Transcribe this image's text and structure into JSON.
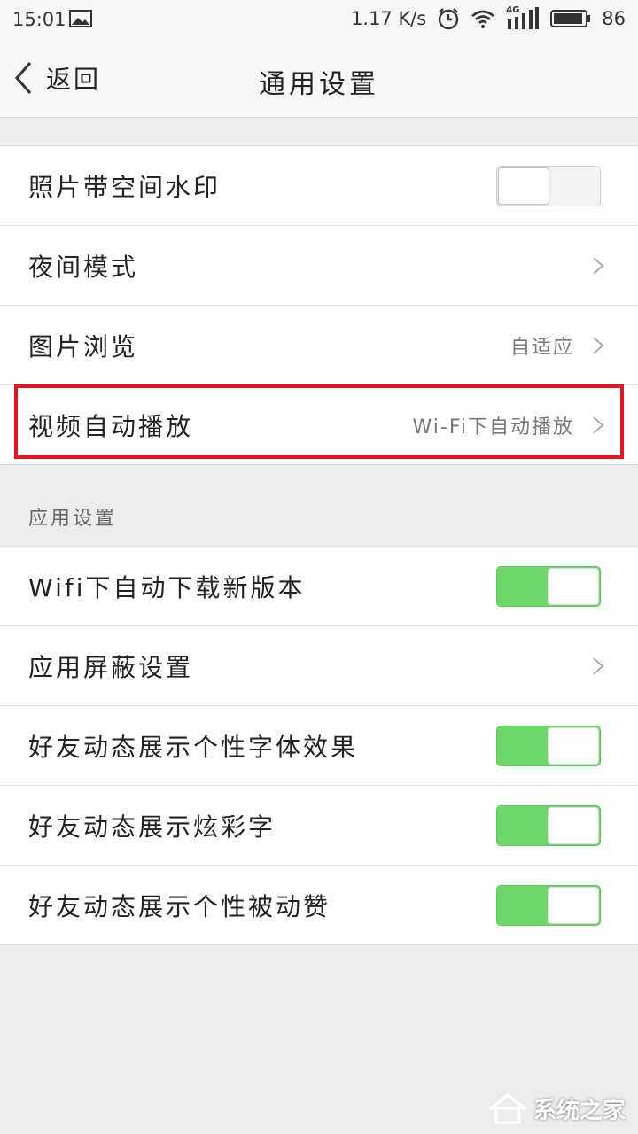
{
  "status_bar": {
    "time": "15:01",
    "network_speed": "1.17 K/s",
    "network_type": "4G",
    "battery": "86",
    "icons": [
      "image-icon",
      "alarm-icon",
      "wifi-icon",
      "signal-icon",
      "battery-icon"
    ]
  },
  "nav": {
    "back_label": "返回",
    "title": "通用设置"
  },
  "group1": {
    "items": [
      {
        "label": "照片带空间水印",
        "control": "toggle",
        "on": false
      },
      {
        "label": "夜间模式",
        "control": "chevron"
      },
      {
        "label": "图片浏览",
        "value": "自适应",
        "control": "chevron"
      },
      {
        "label": "视频自动播放",
        "value": "Wi-Fi下自动播放",
        "control": "chevron",
        "highlighted": true
      }
    ]
  },
  "section2": {
    "header": "应用设置",
    "items": [
      {
        "label": "Wifi下自动下载新版本",
        "control": "toggle",
        "on": true
      },
      {
        "label": "应用屏蔽设置",
        "control": "chevron"
      },
      {
        "label": "好友动态展示个性字体效果",
        "control": "toggle",
        "on": true
      },
      {
        "label": "好友动态展示炫彩字",
        "control": "toggle",
        "on": true
      },
      {
        "label": "好友动态展示个性被动赞",
        "control": "toggle",
        "on": true
      }
    ]
  },
  "watermark": {
    "text": "系统之家"
  },
  "colors": {
    "toggle_on": "#6bd867",
    "highlight_border": "#e8141d",
    "background": "#ececec"
  }
}
